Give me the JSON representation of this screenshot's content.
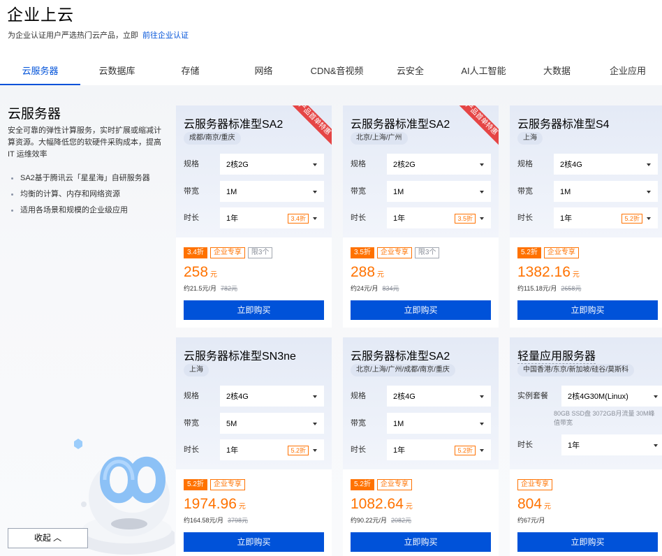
{
  "header": {
    "title": "企业上云",
    "subtitle": "为企业认证用户严选热门云产品，立即",
    "link": "前往企业认证"
  },
  "tabs": [
    {
      "label": "云服务器",
      "active": true
    },
    {
      "label": "云数据库"
    },
    {
      "label": "存储"
    },
    {
      "label": "网络"
    },
    {
      "label": "CDN&音视频"
    },
    {
      "label": "云安全"
    },
    {
      "label": "AI人工智能"
    },
    {
      "label": "大数据"
    },
    {
      "label": "企业应用"
    }
  ],
  "left": {
    "title": "云服务器",
    "desc": "安全可靠的弹性计算服务，实时扩展或缩减计算资源。大幅降低您的软硬件采购成本，提高 IT 运维效率",
    "bullets": [
      "SA2基于腾讯云「星星海」自研服务器",
      "均衡的计算、内存和网络资源",
      "适用各场景和规模的企业级应用"
    ],
    "collapse": "收起"
  },
  "labels": {
    "spec": "规格",
    "bandwidth": "带宽",
    "duration": "时长",
    "package": "实例套餐",
    "buy": "立即购买",
    "ribbon": "产品首单特惠"
  },
  "colors": {
    "brand": "#0052d9",
    "accent": "#ff7200",
    "ribbon": "#e54545"
  },
  "cards": [
    {
      "name": "云服务器标准型SA2",
      "region": "成都/南京/重庆",
      "spec": "2核2G",
      "bandwidth": "1M",
      "duration": "1年",
      "discount": "3.4折",
      "tags": [
        "3.4折",
        "企业专享",
        "限3个"
      ],
      "price": "258",
      "unit": "元",
      "monthly": "约21.5元/月",
      "orig": "782元",
      "ribbon": true
    },
    {
      "name": "云服务器标准型SA2",
      "region": "北京/上海/广州",
      "spec": "2核2G",
      "bandwidth": "1M",
      "duration": "1年",
      "discount": "3.5折",
      "tags": [
        "3.5折",
        "企业专享",
        "限3个"
      ],
      "price": "288",
      "unit": "元",
      "monthly": "约24元/月",
      "orig": "834元",
      "ribbon": true
    },
    {
      "name": "云服务器标准型S4",
      "region": "上海",
      "spec": "2核4G",
      "bandwidth": "1M",
      "duration": "1年",
      "discount": "5.2折",
      "tags": [
        "5.2折",
        "企业专享"
      ],
      "price": "1382.16",
      "unit": "元",
      "monthly": "约115.18元/月",
      "orig": "2658元"
    },
    {
      "name": "云服务器标准型SN3ne",
      "region": "上海",
      "spec": "2核4G",
      "bandwidth": "5M",
      "duration": "1年",
      "discount": "5.2折",
      "tags": [
        "5.2折",
        "企业专享"
      ],
      "price": "1974.96",
      "unit": "元",
      "monthly": "约164.58元/月",
      "orig": "3798元"
    },
    {
      "name": "云服务器标准型SA2",
      "region": "北京/上海/广州/成都/南京/重庆",
      "spec": "2核4G",
      "bandwidth": "1M",
      "duration": "1年",
      "discount": "5.2折",
      "tags": [
        "5.2折",
        "企业专享"
      ],
      "price": "1082.64",
      "unit": "元",
      "monthly": "约90.22元/月",
      "orig": "2082元"
    },
    {
      "name": "轻量应用服务器",
      "region": "中国香港/东京/新加坡/硅谷/莫斯科",
      "package": "2核4G30M(Linux)",
      "package_note": "80GB SSD盘 3072GB月流量 30M峰值带宽",
      "duration": "1年",
      "tags": [
        "企业专享"
      ],
      "price": "804",
      "unit": "元",
      "monthly": "约67元/月"
    }
  ]
}
